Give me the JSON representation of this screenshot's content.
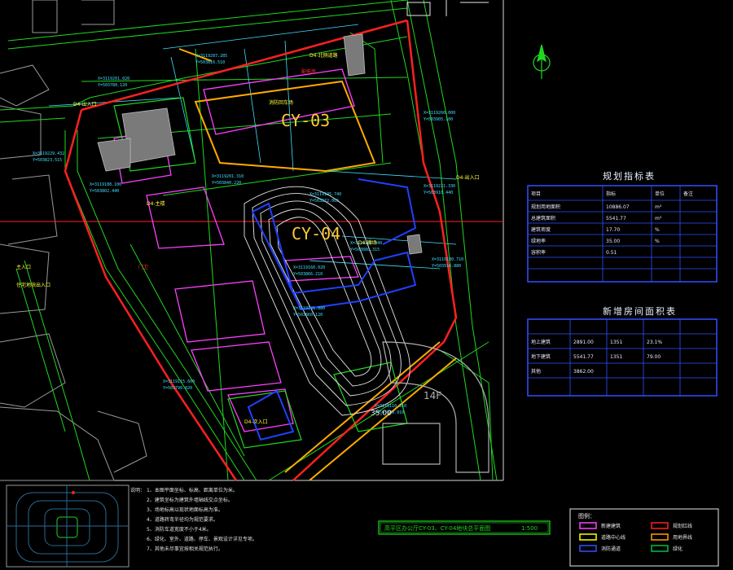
{
  "drawing": {
    "labels": {
      "cy03": "CY-03",
      "cy04": "CY-04",
      "floors_14f": "14F",
      "dim_3500": "35.00"
    },
    "coordinates": [
      "X=3119287.285",
      "Y=503816.510",
      "X=3119229.432",
      "Y=503823.515",
      "X=3119120.195"
    ],
    "north_arrow": "north-arrow-icon"
  },
  "tables": {
    "planning_index_title": "规划指标表",
    "new_building_area_title": "新增房间面积表",
    "planning_rows": [
      [
        "项目",
        "指标",
        "单位",
        "备注"
      ],
      [
        "规划用地面积",
        "10886.07",
        "m²",
        ""
      ],
      [
        "总建筑面积",
        "5541.77",
        "m²",
        ""
      ],
      [
        "建筑密度",
        "17.70",
        "%",
        ""
      ],
      [
        "绿地率",
        "35.00",
        "%",
        ""
      ],
      [
        "容积率",
        "0.51",
        "",
        ""
      ]
    ],
    "area_rows": [
      [
        "地上建筑",
        "2891.00",
        "1351",
        "23.1%"
      ],
      [
        "地下建筑",
        "5541.77",
        "1351",
        "79.00"
      ],
      [
        "其他",
        "3862.00",
        "",
        ""
      ]
    ]
  },
  "title_block": {
    "title": "高平区办公厅CY-03、CY-04地块总平面图",
    "scale": "1:500"
  },
  "notes": {
    "heading": "说明：",
    "lines": [
      "1、本图平面坐标、标高、距离单位为米。",
      "2、建筑坐标为建筑外墙轴线交点坐标。",
      "3、场地标高以现状地面标高为准。",
      "4、道路转弯半径均为规范要求。",
      "5、消防车道宽度不小于4米。",
      "6、绿化、室外、道路、停车、景观设计详见专项。",
      "7、其他未尽事宜按相关规范执行。"
    ]
  },
  "legend": {
    "heading": "图例：",
    "items": [
      {
        "label": "新建建筑",
        "color": "#ff40ff"
      },
      {
        "label": "规划红线",
        "color": "#ff2020"
      },
      {
        "label": "道路中心线",
        "color": "#ffff00"
      },
      {
        "label": "用地界线",
        "color": "#ffa000"
      },
      {
        "label": "消防通道",
        "color": "#3050ff"
      },
      {
        "label": "绿化",
        "color": "#00c040"
      }
    ]
  },
  "colors": {
    "background": "#000000",
    "road_green": "#1fd81f",
    "red_line": "#ff2020",
    "boundary_orange": "#ffaa00",
    "magenta": "#ff40ff",
    "blue": "#2040ff",
    "white": "#e8e8e8",
    "yellow": "#ffff40",
    "cyan": "#40e0ff"
  }
}
